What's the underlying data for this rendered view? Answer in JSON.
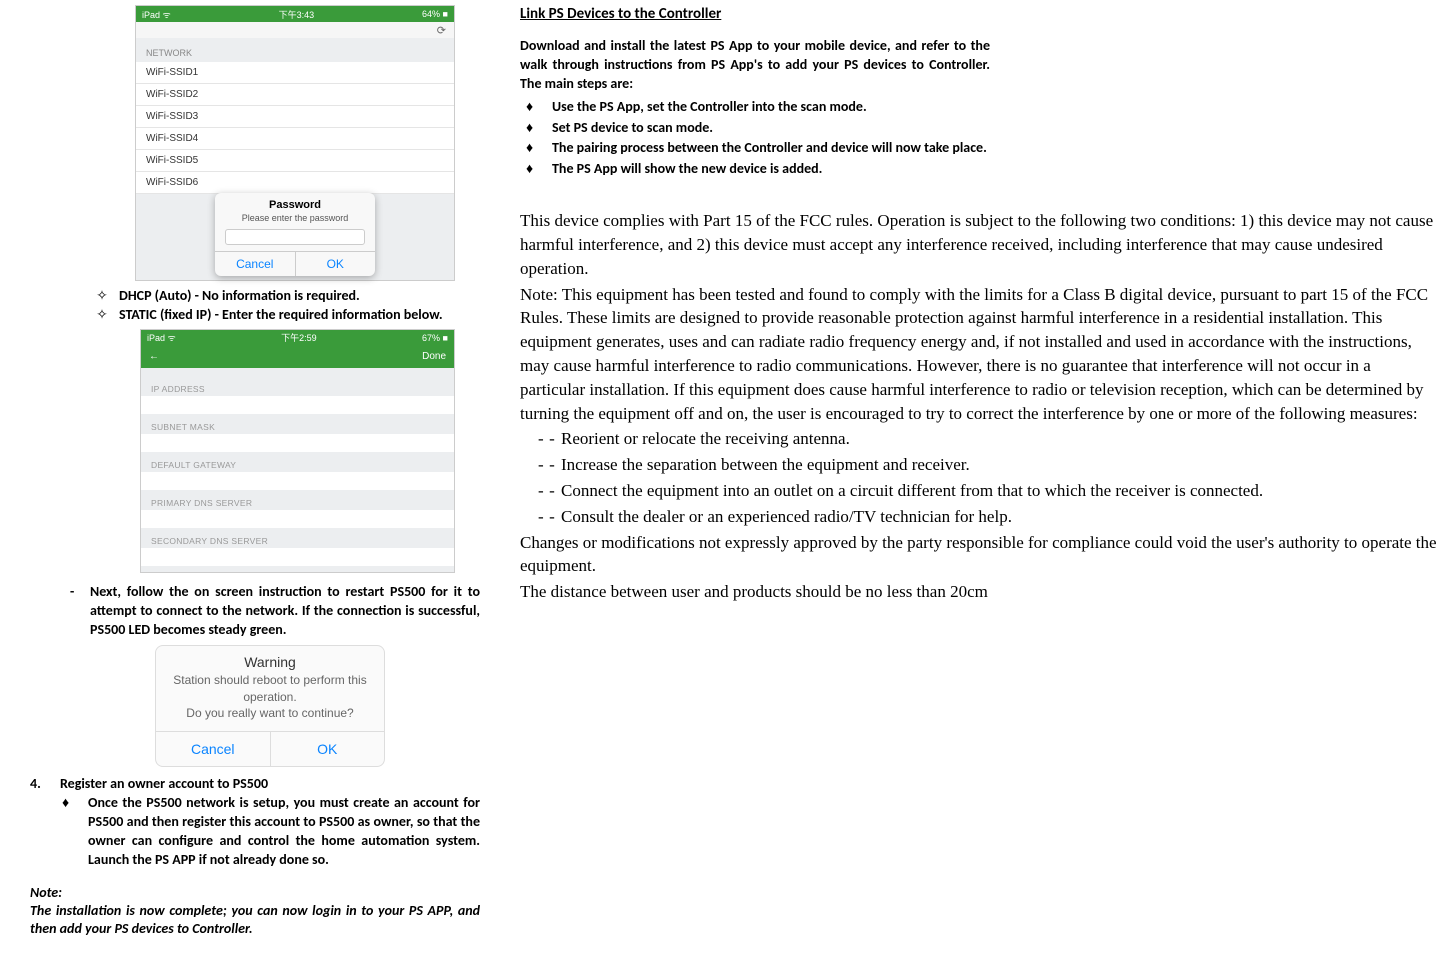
{
  "left": {
    "shot1": {
      "status_left": "iPad ᯤ",
      "status_mid": "下午3:43",
      "status_right": "64% ■",
      "refresh": "⟳",
      "section": "NETWORK",
      "rows": [
        "WiFi-SSID1",
        "WiFi-SSID2",
        "WiFi-SSID3",
        "WiFi-SSID4",
        "WiFi-SSID5",
        "WiFi-SSID6"
      ],
      "modal_title": "Password",
      "modal_sub": "Please enter the password",
      "modal_cancel": "Cancel",
      "modal_ok": "OK"
    },
    "diamonds": [
      "DHCP (Auto) - No information is required.",
      "STATIC (fixed IP) - Enter the required information below."
    ],
    "shot2": {
      "status_left": "iPad ᯤ",
      "status_mid": "下午2:59",
      "status_right": "67% ■",
      "done": "Done",
      "labels": [
        "IP ADDRESS",
        "SUBNET MASK",
        "DEFAULT GATEWAY",
        "PRIMARY DNS SERVER",
        "SECONDARY DNS SERVER"
      ]
    },
    "next_para": "Next, follow the on screen instruction to restart PS500 for it to attempt to connect to the network.  If the connection is successful, PS500 LED becomes steady green.",
    "shot3": {
      "title": "Warning",
      "body1": "Station should reboot to perform this operation.",
      "body2": "Do you really want to continue?",
      "cancel": "Cancel",
      "ok": "OK"
    },
    "step4_num": "4.",
    "step4_title": "Register an owner account to PS500",
    "step4_body": "Once the PS500 network is setup, you must create an account for PS500 and then register this account to PS500 as owner, so that the owner can configure and control the home automation system. Launch the PS APP if not already done so.",
    "note_label": "Note:",
    "note_body": "The installation is now complete; you can now login in to your PS APP, and then add your PS devices to Controller."
  },
  "right": {
    "heading": "Link PS Devices to the Controller",
    "intro": "Download and install the latest PS App to your mobile device, and refer to the walk through instructions from PS App's to add your PS devices to Controller. The main steps are:",
    "bullets": [
      "Use the PS App, set the Controller into the scan mode.",
      "Set PS device to scan mode.",
      "The pairing process between the Controller and device will now take place.",
      "The PS App will show the new device is added."
    ],
    "fcc": {
      "p1": "This device complies with Part 15 of the FCC rules. Operation is subject to the following two conditions: 1) this device may not cause harmful interference, and 2) this device must accept any interference received, including interference that may cause undesired operation.",
      "p2": "Note: This equipment has been tested and found to comply with the limits for a Class B digital device, pursuant to part 15 of the FCC Rules. These limits are designed to provide reasonable protection against harmful interference in a residential installation. This equipment generates, uses and can radiate radio frequency energy and, if not installed and used in accordance with the instructions, may cause harmful interference to radio communications. However, there is no guarantee that interference will not occur in a particular installation. If this equipment does cause harmful interference to radio or television reception, which can be determined by turning the equipment off and on, the user is encouraged to try to correct the interference by one or more of the following measures:",
      "m1": "Reorient or relocate the receiving antenna.",
      "m2": "Increase the separation between the equipment and receiver.",
      "m3": "Connect the equipment into an outlet on a circuit different from that to which the receiver is connected.",
      "m4": "Consult the dealer or an experienced radio/TV technician for help.",
      "p3": "Changes or modifications not expressly approved by the party responsible for compliance could void the user's authority to operate the equipment.",
      "p4": "The distance between user and products should be no less than 20cm"
    }
  }
}
